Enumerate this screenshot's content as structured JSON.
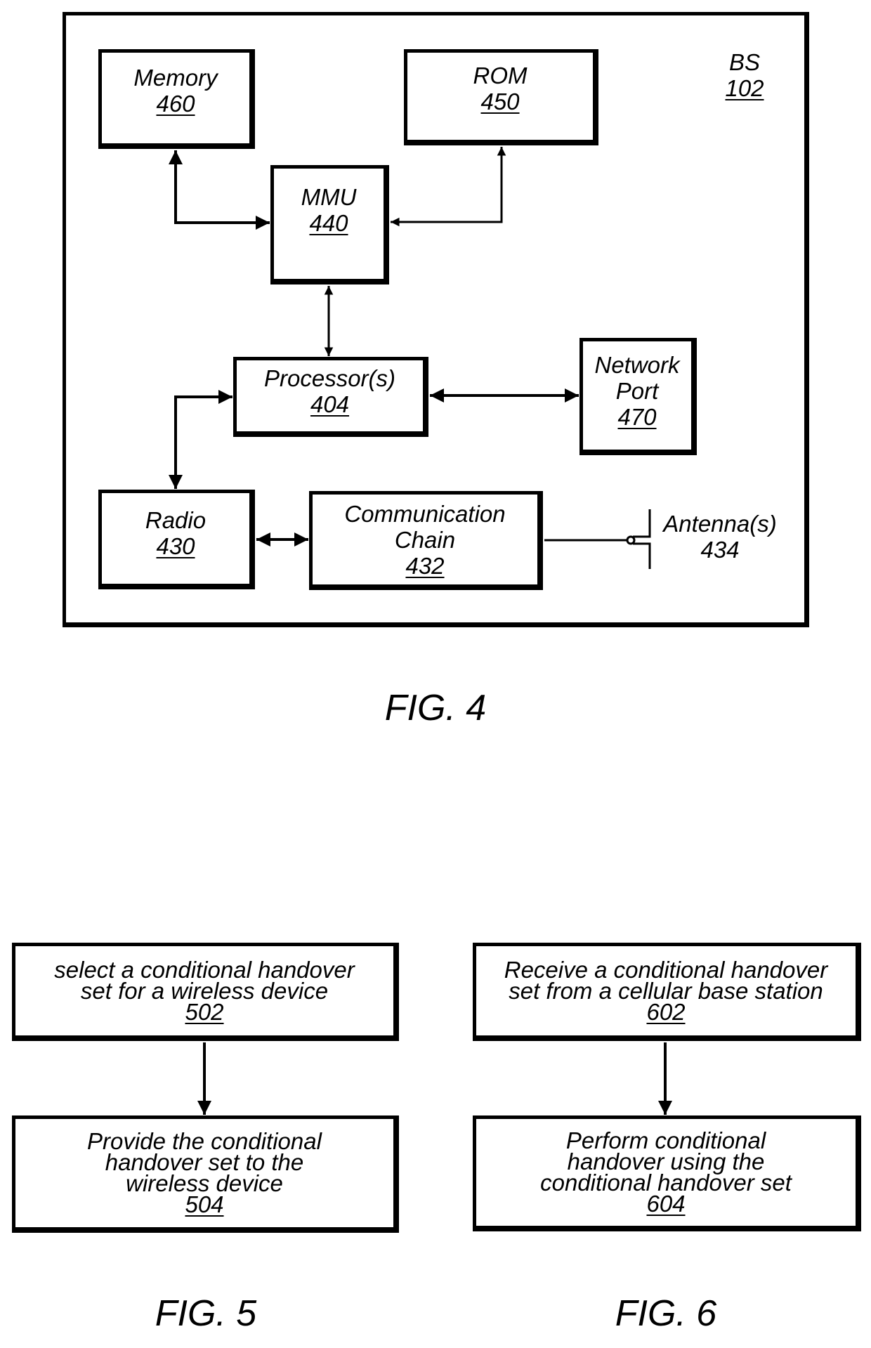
{
  "fig4": {
    "caption": "FIG. 4",
    "container": {
      "name": "BS",
      "ref": "102"
    },
    "blocks": {
      "memory": {
        "name": "Memory",
        "ref": "460"
      },
      "rom": {
        "name": "ROM",
        "ref": "450"
      },
      "mmu": {
        "name": "MMU",
        "ref": "440"
      },
      "processor": {
        "name": "Processor(s)",
        "ref": "404"
      },
      "network_port": {
        "line1": "Network",
        "line2": "Port",
        "ref": "470"
      },
      "radio": {
        "name": "Radio",
        "ref": "430"
      },
      "comm_chain": {
        "line1": "Communication",
        "line2": "Chain",
        "ref": "432"
      },
      "antenna": {
        "name": "Antenna(s)",
        "ref": "434"
      }
    },
    "connections": [
      {
        "from": "Memory 460",
        "to": "MMU 440",
        "type": "bidirectional"
      },
      {
        "from": "ROM 450",
        "to": "MMU 440",
        "type": "bidirectional"
      },
      {
        "from": "MMU 440",
        "to": "Processor(s) 404",
        "type": "bidirectional"
      },
      {
        "from": "Processor(s) 404",
        "to": "Network Port 470",
        "type": "bidirectional"
      },
      {
        "from": "Processor(s) 404",
        "to": "Radio 430",
        "type": "bidirectional"
      },
      {
        "from": "Radio 430",
        "to": "Communication Chain 432",
        "type": "bidirectional"
      },
      {
        "from": "Communication Chain 432",
        "to": "Antenna(s) 434",
        "type": "line"
      }
    ]
  },
  "fig5": {
    "caption": "FIG. 5",
    "steps": [
      {
        "lines": [
          "select a conditional handover",
          "set for a wireless device"
        ],
        "ref": "502"
      },
      {
        "lines": [
          "Provide the conditional",
          "handover set to the",
          "wireless device"
        ],
        "ref": "504"
      }
    ]
  },
  "fig6": {
    "caption": "FIG. 6",
    "steps": [
      {
        "lines": [
          "Receive a conditional handover",
          "set from a cellular base station"
        ],
        "ref": "602"
      },
      {
        "lines": [
          "Perform conditional",
          "handover using the",
          "conditional handover set"
        ],
        "ref": "604"
      }
    ]
  }
}
